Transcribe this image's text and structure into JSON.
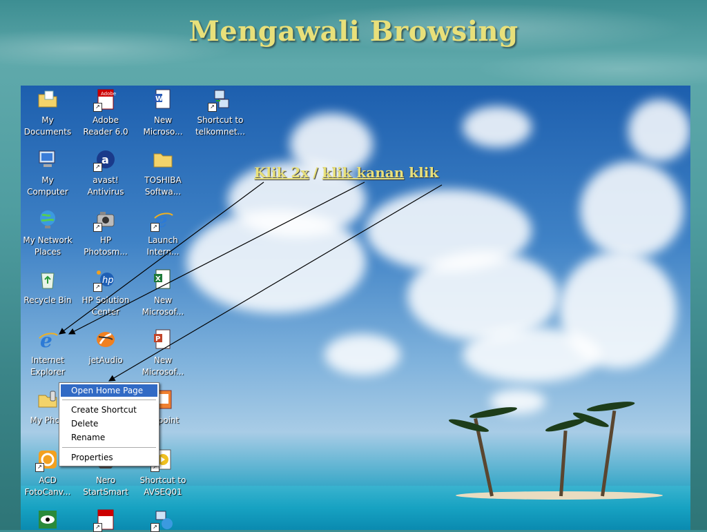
{
  "slide": {
    "title": "Mengawali Browsing"
  },
  "annotation": {
    "part1": "Klik 2x",
    "separator": "/",
    "part2": "klik kanan",
    "part3": "klik"
  },
  "desktop_icons": {
    "my_documents": "My\nDocuments",
    "adobe_reader": "Adobe\nReader 6.0",
    "new_word": "New\nMicroso...",
    "shortcut_telkom": "Shortcut to\ntelkomnet...",
    "my_computer": "My\nComputer",
    "avast": "avast!\nAntivirus",
    "toshiba": "TOSHIBA\nSoftwa...",
    "network_places": "My Network\nPlaces",
    "hp_photosmart": "HP\nPhotosm...",
    "launch_ie": "Launch\nIntern...",
    "recycle_bin": "Recycle Bin",
    "hp_solution": "HP Solution\nCenter",
    "new_excel": "New\nMicrosof...",
    "internet_explorer": "Internet\nExplorer",
    "jetaudio": "jetAudio",
    "new_ppt": "New\nMicrosof...",
    "my_phone": "My Phon",
    "power_point": "er point",
    "acd": "ACD\nFotoCanv...",
    "nero": "Nero\nStartSmart",
    "shortcut_avseq": "Shortcut to\nAVSEQ01"
  },
  "context_menu": {
    "open_home_page": "Open Home Page",
    "create_shortcut": "Create Shortcut",
    "delete": "Delete",
    "rename": "Rename",
    "properties": "Properties"
  },
  "colors": {
    "title": "#e8e07a",
    "menu_highlight": "#316ac5"
  }
}
